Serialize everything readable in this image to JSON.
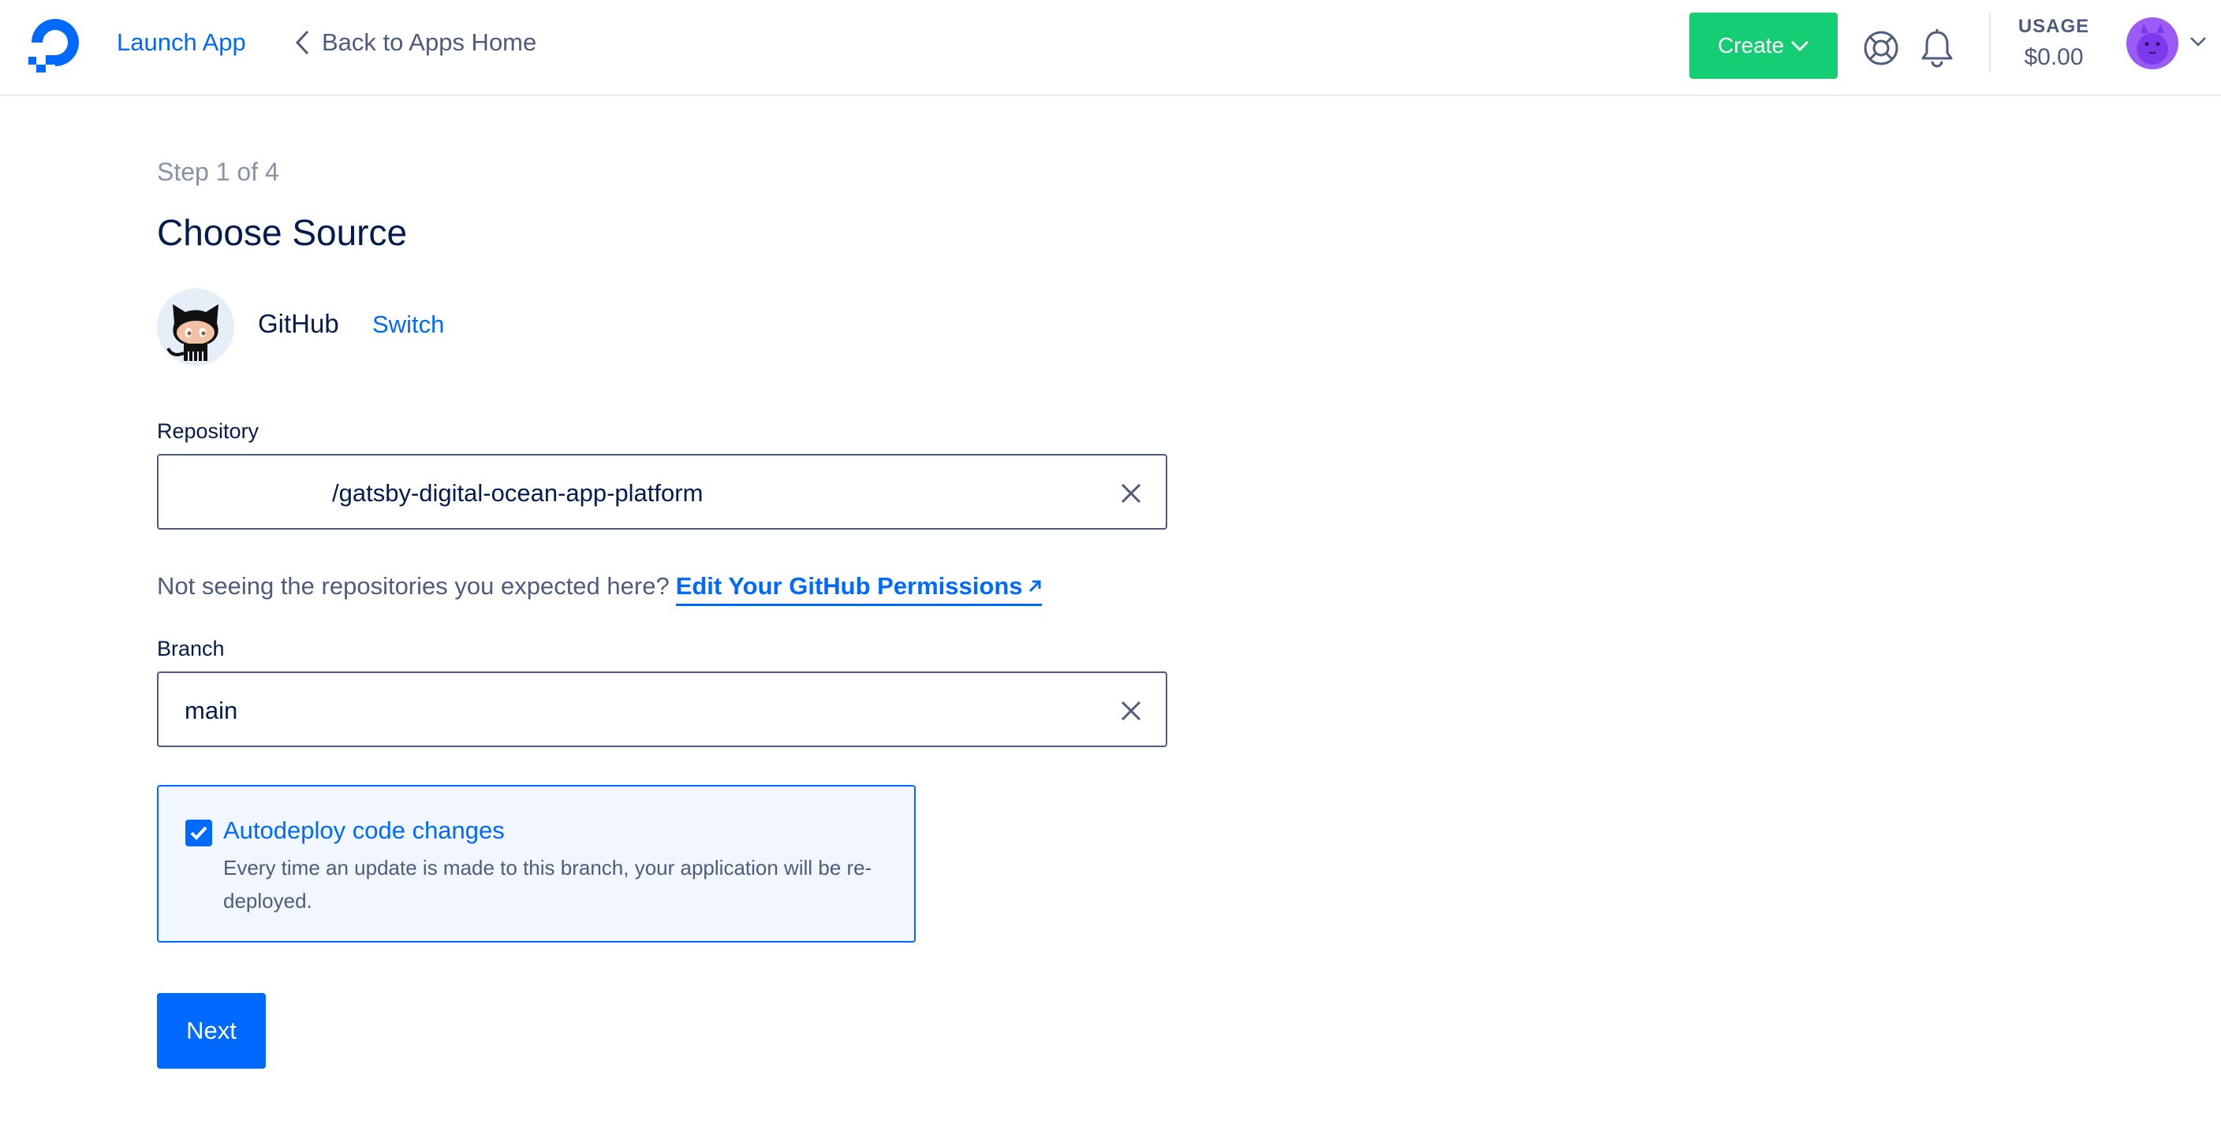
{
  "header": {
    "app_title": "Launch App",
    "back_label": "Back to Apps Home",
    "create_label": "Create",
    "usage_label": "USAGE",
    "usage_value": "$0.00",
    "icons": [
      "digitalocean-logo-icon",
      "back-chevron-icon",
      "chevron-down-icon",
      "help-lifebuoy-icon",
      "notification-bell-icon",
      "user-avatar-icon"
    ]
  },
  "wizard": {
    "step": "Step 1 of 4",
    "title": "Choose Source",
    "provider": {
      "name": "GitHub",
      "switch_label": "Switch"
    },
    "repository": {
      "label": "Repository",
      "value": "/gatsby-digital-ocean-app-platform"
    },
    "hint": {
      "text": "Not seeing the repositories you expected here?",
      "link_label": "Edit Your GitHub Permissions"
    },
    "branch": {
      "label": "Branch",
      "value": "main"
    },
    "autodeploy": {
      "checked": true,
      "title": "Autodeploy code changes",
      "description": "Every time an update is made to this branch, your application will be re-deployed."
    },
    "next_label": "Next"
  },
  "colors": {
    "brand_blue": "#0069ff",
    "create_green": "#15cd72",
    "text_dark": "#031b4e",
    "text_muted": "#4d5b7c"
  }
}
